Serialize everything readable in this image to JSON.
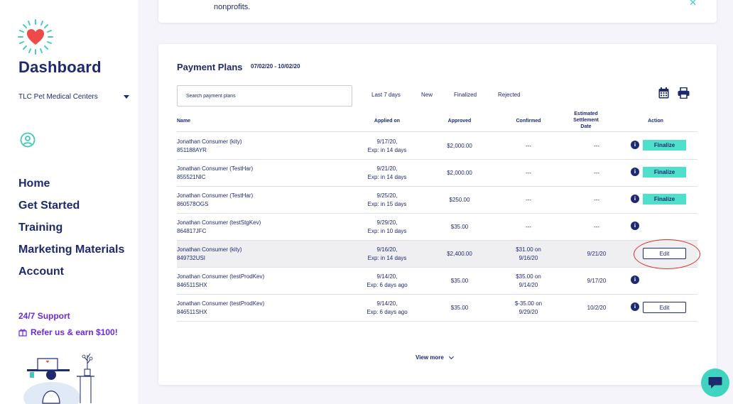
{
  "sidebar": {
    "logo_icon": "heart-sun-icon",
    "brand": "Dashboard",
    "org_name": "TLC Pet Medical Centers",
    "nav": [
      "Home",
      "Get Started",
      "Training",
      "Marketing Materials",
      "Account"
    ],
    "support": "24/7 Support",
    "refer": "Refer us & earn $100!"
  },
  "top_card": {
    "text": "nonprofits.",
    "close_icon": "close-icon"
  },
  "plans": {
    "title": "Payment Plans",
    "date_range": "07/02/20 - 10/02/20",
    "search_placeholder": "Search payment plans",
    "filters": [
      "Last 7 days",
      "New",
      "Finalized",
      "Rejected"
    ],
    "columns": {
      "name": "Name",
      "applied": "Applied on",
      "approved": "Approved",
      "confirmed": "Confirmed",
      "settlement": "Estimated Settlement Date",
      "action": "Action"
    },
    "rows": [
      {
        "name": "Jonathan Consumer (kity)",
        "id": "851188AYR",
        "applied_date": "9/17/20,",
        "applied_exp": "Exp: in 14 days",
        "approved": "$2,000.00",
        "confirmed": "---",
        "confirmed2": "",
        "settlement": "---",
        "info": true,
        "action": "Finalize"
      },
      {
        "name": "Jonathan Consumer (TestHar)",
        "id": "855521NIC",
        "applied_date": "9/21/20,",
        "applied_exp": "Exp: in 14 days",
        "approved": "$2,000.00",
        "confirmed": "---",
        "confirmed2": "",
        "settlement": "---",
        "info": true,
        "action": "Finalize"
      },
      {
        "name": "Jonathan Consumer (TestHar)",
        "id": "860578OGS",
        "applied_date": "9/25/20,",
        "applied_exp": "Exp: in 15 days",
        "approved": "$250.00",
        "confirmed": "---",
        "confirmed2": "",
        "settlement": "---",
        "info": true,
        "action": "Finalize"
      },
      {
        "name": "Jonathan Consumer (testStgKev)",
        "id": "864817JFC",
        "applied_date": "9/29/20,",
        "applied_exp": "Exp: in 10 days",
        "approved": "$35.00",
        "confirmed": "---",
        "confirmed2": "",
        "settlement": "---",
        "info": true,
        "action": ""
      },
      {
        "name": "Jonathan Consumer (kity)",
        "id": "849732USI",
        "applied_date": "9/16/20,",
        "applied_exp": "Exp: in 14 days",
        "approved": "$2,400.00",
        "confirmed": "$31.00 on",
        "confirmed2": "9/16/20",
        "settlement": "9/21/20",
        "info": false,
        "action": "Edit"
      },
      {
        "name": "Jonathan Consumer (testProdKev)",
        "id": "846511SHX",
        "applied_date": "9/14/20,",
        "applied_exp": "Exp: 6 days ago",
        "approved": "$35.00",
        "confirmed": "$35.00 on",
        "confirmed2": "9/14/20",
        "settlement": "9/17/20",
        "info": true,
        "action": ""
      },
      {
        "name": "Jonathan Consumer (testProdKev)",
        "id": "846511SHX",
        "applied_date": "9/14/20,",
        "applied_exp": "Exp: 6 days ago",
        "approved": "$35.00",
        "confirmed": "$-35.00 on",
        "confirmed2": "9/29/20",
        "settlement": "10/2/20",
        "info": true,
        "action": "Edit"
      }
    ],
    "view_more": "View more"
  },
  "colors": {
    "navy": "#1e2a6e",
    "teal": "#4ee0cb",
    "purple": "#6c2bd9",
    "annotation_red": "#d2332b"
  }
}
